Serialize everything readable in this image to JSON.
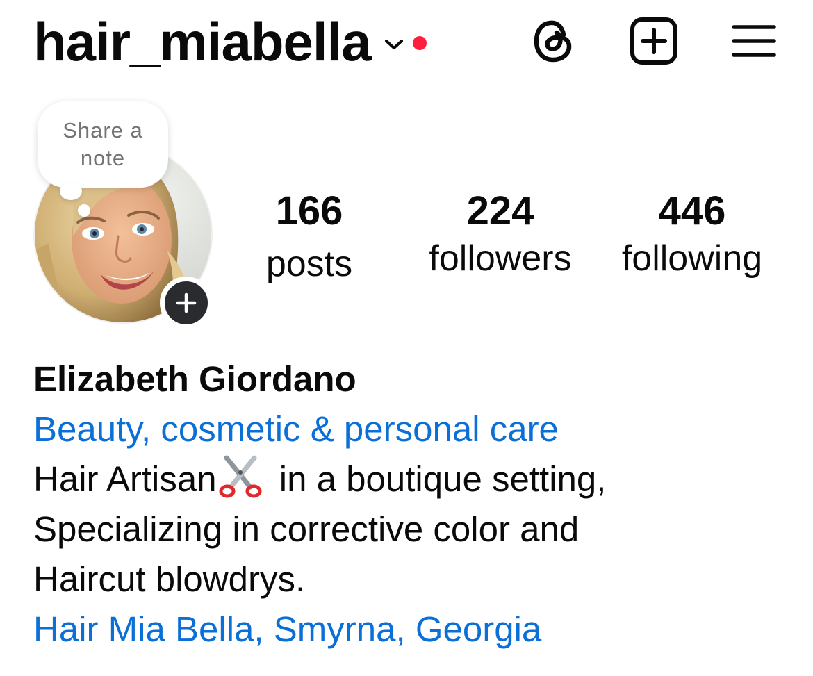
{
  "header": {
    "username": "hair_miabella",
    "has_notification": true,
    "icons": {
      "switch_account": "chevron-down-icon",
      "threads": "threads-icon",
      "create": "plus-square-icon",
      "menu": "hamburger-menu-icon"
    },
    "notification_color": "#ff1f3d"
  },
  "note": {
    "placeholder_line1": "Share a",
    "placeholder_line2": "note"
  },
  "profile": {
    "avatar": "profile-photo",
    "add_story_icon": "plus-icon"
  },
  "stats": {
    "posts": {
      "value": "166",
      "label": "posts"
    },
    "followers": {
      "value": "224",
      "label": "followers"
    },
    "following": {
      "value": "446",
      "label": "following"
    }
  },
  "bio": {
    "full_name": "Elizabeth Giordano",
    "category": "Beauty, cosmetic & personal care",
    "line1_a": "Hair Artisan",
    "line1_emoji": "scissors-emoji",
    "line1_b": " in a boutique setting,",
    "line2": "Specializing in corrective color and",
    "line3": "Haircut blowdrys.",
    "location": "Hair Mia Bella, Smyrna, Georgia"
  },
  "colors": {
    "link": "#0a6fd6",
    "text": "#0a0a0a",
    "muted": "#737373"
  }
}
